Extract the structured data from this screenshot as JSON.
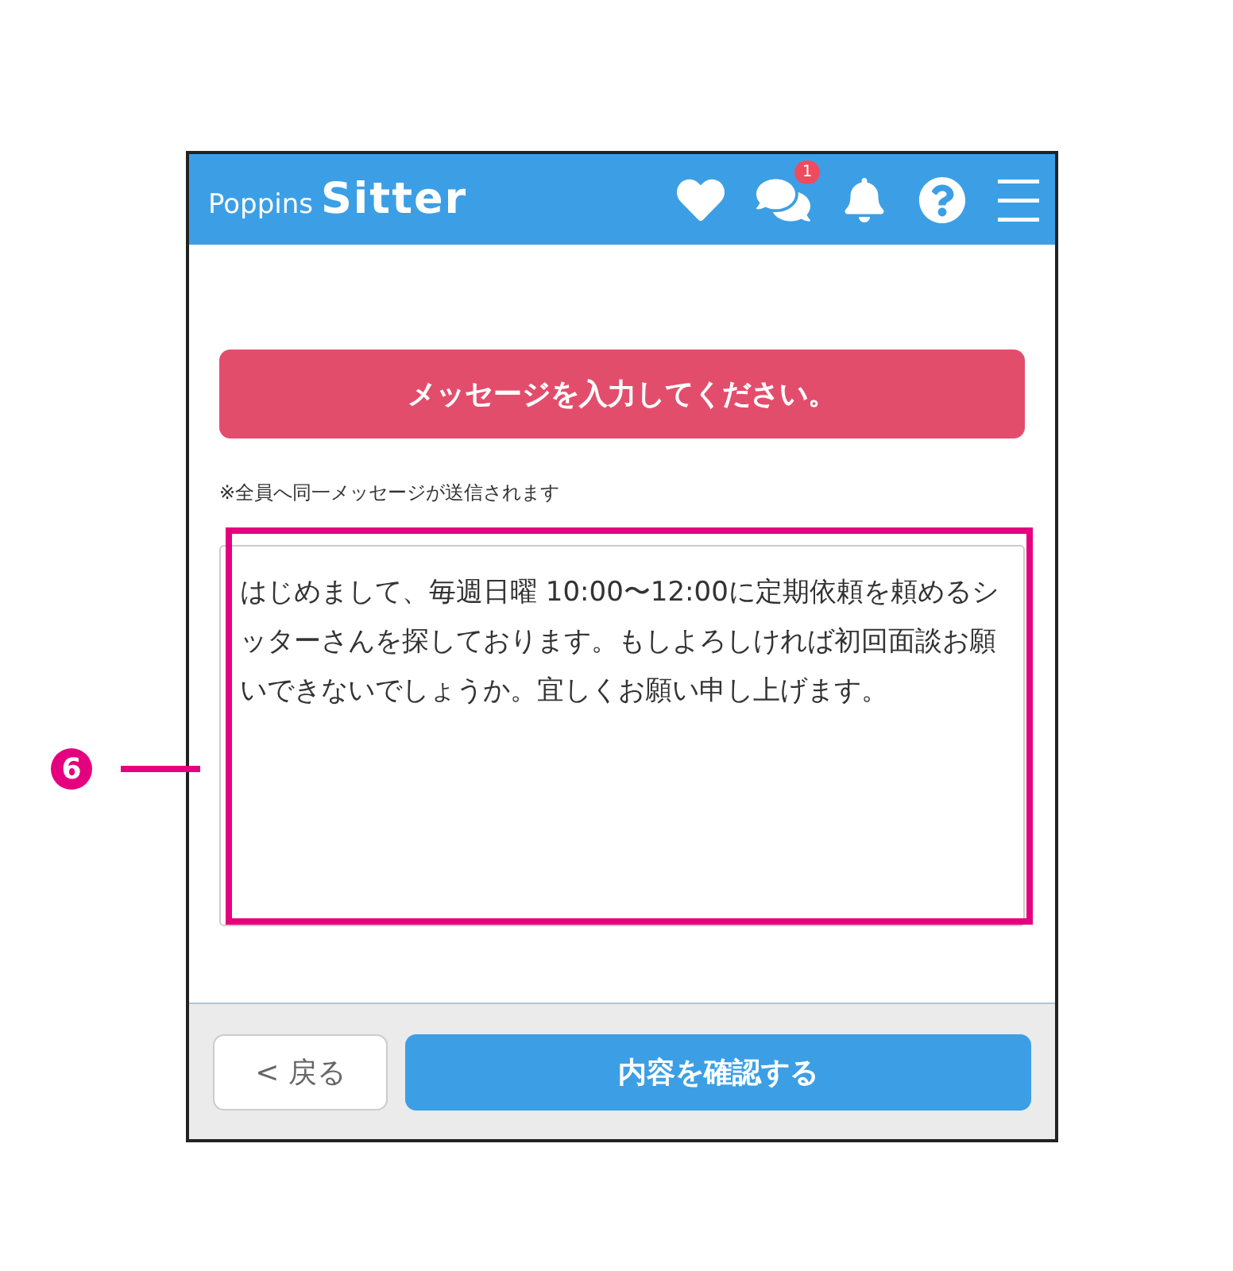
{
  "header": {
    "logo_small": "Poppins",
    "logo_large": "Sitter",
    "chat_badge": "1"
  },
  "alert": "メッセージを入力してください。",
  "note": "※全員へ同一メッセージが送信されます",
  "message": {
    "value": "はじめまして、毎週日曜 10:00〜12:00に定期依頼を頼めるシッターさんを探しております。もしよろしければ初回面談お願いできないでしょうか。宜しくお願い申し上げます。"
  },
  "footer": {
    "back_button": "< 戻る",
    "confirm_button": "内容を確認する"
  },
  "callout": {
    "number": "6"
  }
}
